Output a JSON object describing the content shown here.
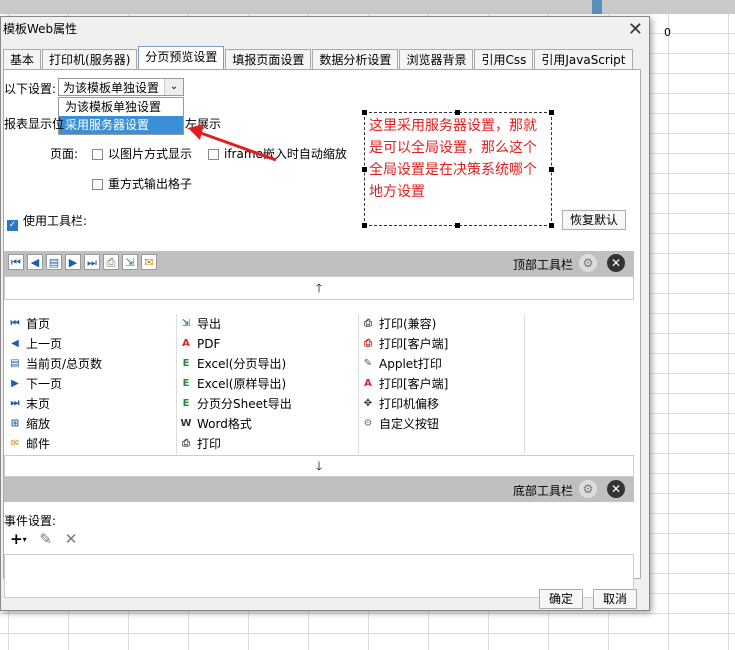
{
  "background": {
    "cell_value": "0"
  },
  "dialog": {
    "title": "模板Web属性",
    "tabs": [
      "基本",
      "打印机(服务器)",
      "分页预览设置",
      "填报页面设置",
      "数据分析设置",
      "浏览器背景",
      "引用Css",
      "引用JavaScript"
    ],
    "settings_label": "以下设置:",
    "select_value": "为该模板单独设置",
    "dropdown_options": [
      "为该模板单独设置",
      "采用服务器设置"
    ],
    "report_display_label": "报表显示位",
    "report_display_value": "左展示",
    "page_label": "页面:",
    "opt_image": "以图片方式显示",
    "opt_iframe": "iframe嵌入时自动缩放",
    "opt_reprint": "重方式输出格子",
    "use_toolbar": "使用工具栏:",
    "restore_default": "恢复默认",
    "top_toolbar": "顶部工具栏",
    "bottom_toolbar": "底部工具栏",
    "annotation": "这里采用服务器设置，那就是可以全局设置，那么这个全局设置是在决策系统哪个地方设置",
    "buttons_col1": [
      "首页",
      "上一页",
      "当前页/总页数",
      "下一页",
      "末页",
      "缩放",
      "邮件"
    ],
    "buttons_col2": [
      "导出",
      "PDF",
      "Excel(分页导出)",
      "Excel(原样导出)",
      "分页分Sheet导出",
      "Word格式",
      "打印"
    ],
    "buttons_col3": [
      "打印(兼容)",
      "打印[客户端]",
      "Applet打印",
      "打印[客户端]",
      "打印机偏移",
      "自定义按钮"
    ],
    "events_label": "事件设置:",
    "ok": "确定",
    "cancel": "取消"
  },
  "colors": {
    "annotation": "#e02020",
    "arrow": "#e02020",
    "accent": "#3b8fd6"
  }
}
